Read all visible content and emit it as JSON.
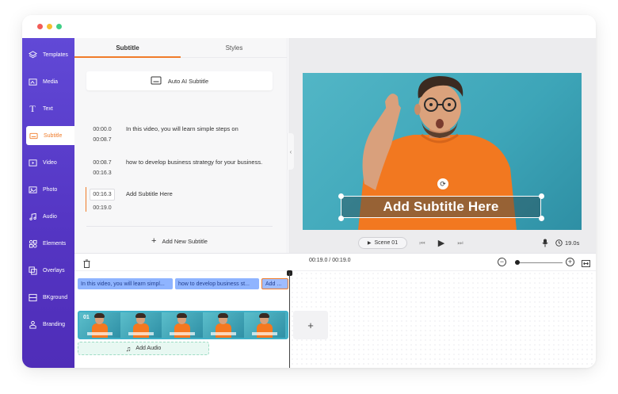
{
  "window": {
    "traffic_lights": [
      "#f25c57",
      "#f6be2f",
      "#3fcf86"
    ]
  },
  "sidebar": {
    "accent": "#5536c4",
    "items": [
      {
        "label": "Templates",
        "icon": "layers-icon"
      },
      {
        "label": "Media",
        "icon": "media-icon"
      },
      {
        "label": "Text",
        "icon": "text-icon"
      },
      {
        "label": "Subtitle",
        "icon": "subtitle-icon",
        "active": true
      },
      {
        "label": "Video",
        "icon": "video-icon"
      },
      {
        "label": "Photo",
        "icon": "photo-icon"
      },
      {
        "label": "Audio",
        "icon": "music-icon"
      },
      {
        "label": "Elements",
        "icon": "elements-icon"
      },
      {
        "label": "Overlays",
        "icon": "overlays-icon"
      },
      {
        "label": "BKground",
        "icon": "background-icon"
      },
      {
        "label": "Branding",
        "icon": "branding-icon"
      }
    ]
  },
  "panel": {
    "tabs": [
      "Subtitle",
      "Styles"
    ],
    "auto_button": "Auto AI Subtitle",
    "subtitles": [
      {
        "start": "00:00.0",
        "end": "00:08.7",
        "text": "In this video, you will learn simple steps on"
      },
      {
        "start": "00:08.7",
        "end": "00:16.3",
        "text": "how to develop business strategy for your business."
      },
      {
        "start": "00:16.3",
        "end": "00:19.0",
        "text": "Add Subtitle Here"
      }
    ],
    "add_new": "Add New Subtitle"
  },
  "preview": {
    "caption": "Add Subtitle Here",
    "scene_label": "Scene 01",
    "duration": "19.0s"
  },
  "timeline": {
    "time_readout": "00:19.0 / 00:19.0",
    "zoom_level": 0.0,
    "subtitle_chips": [
      "In this video, you will learn simpl...",
      "how to develop business st...",
      "Add ..."
    ],
    "clip_number": "01",
    "add_audio": "Add Audio",
    "add_scene": "+"
  },
  "colors": {
    "accent_orange": "#f07c2a",
    "chip_blue": "#8fb4ff",
    "audio_green": "#e8f8f2"
  }
}
